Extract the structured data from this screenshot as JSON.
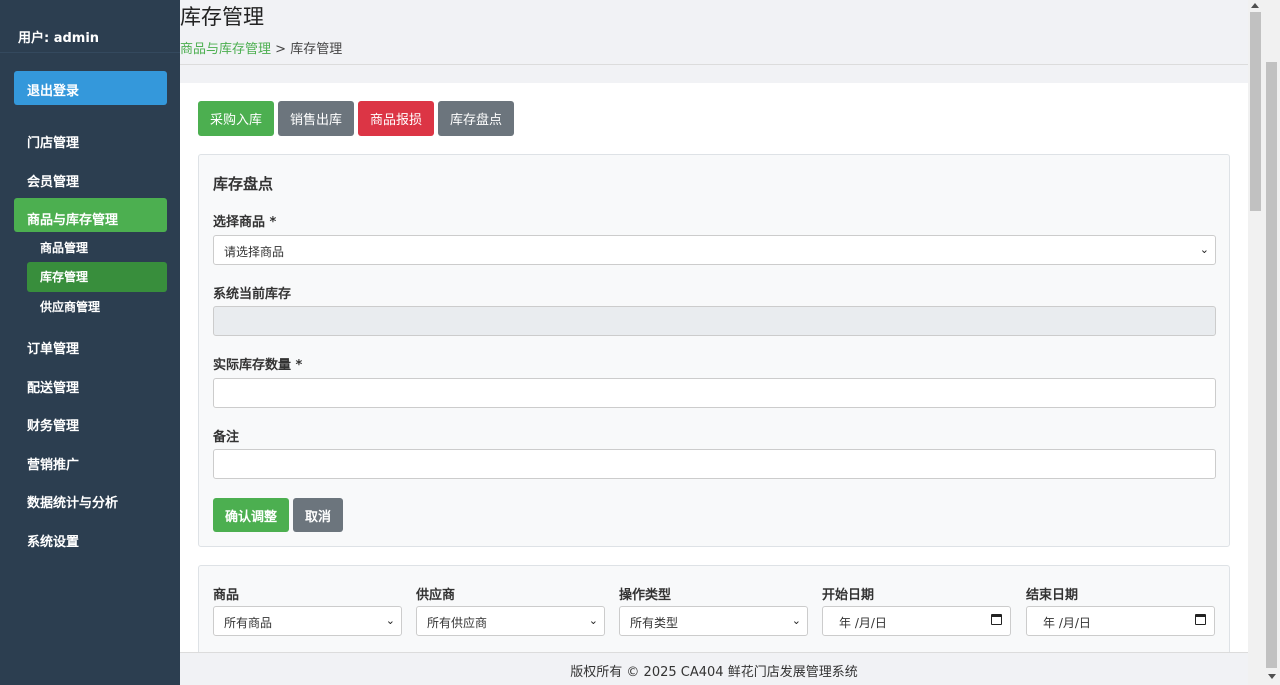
{
  "sidebar": {
    "user_label": "用户: admin",
    "logout_label": "退出登录",
    "items": [
      {
        "label": "门店管理"
      },
      {
        "label": "会员管理"
      },
      {
        "label": "商品与库存管理",
        "active": true
      },
      {
        "label": "订单管理"
      },
      {
        "label": "配送管理"
      },
      {
        "label": "财务管理"
      },
      {
        "label": "营销推广"
      },
      {
        "label": "数据统计与分析"
      },
      {
        "label": "系统设置"
      }
    ],
    "sub_items": [
      {
        "label": "商品管理"
      },
      {
        "label": "库存管理",
        "active": true
      },
      {
        "label": "供应商管理"
      }
    ]
  },
  "header": {
    "title": "库存管理",
    "breadcrumb_link": "商品与库存管理",
    "breadcrumb_sep": ">",
    "breadcrumb_current": "库存管理"
  },
  "actions": {
    "purchase_in": "采购入库",
    "sale_out": "销售出库",
    "damage": "商品报损",
    "stocktake": "库存盘点"
  },
  "form": {
    "title": "库存盘点",
    "product_label": "选择商品 *",
    "product_value": "请选择商品",
    "current_stock_label": "系统当前库存",
    "current_stock_value": "",
    "actual_qty_label": "实际库存数量 *",
    "actual_qty_value": "",
    "remark_label": "备注",
    "remark_value": "",
    "confirm_label": "确认调整",
    "cancel_label": "取消"
  },
  "filters": {
    "product_label": "商品",
    "product_value": "所有商品",
    "supplier_label": "供应商",
    "supplier_value": "所有供应商",
    "type_label": "操作类型",
    "type_value": "所有类型",
    "start_label": "开始日期",
    "start_value": "年 /月/日",
    "end_label": "结束日期",
    "end_value": "年 /月/日"
  },
  "footer": {
    "text": "版权所有 © 2025 CA404 鲜花门店发展管理系统"
  },
  "colors": {
    "sidebar_bg": "#2c3e50",
    "primary_blue": "#3498db",
    "accent_green": "#4caf50",
    "active_sub_green": "#388e3c",
    "danger_red": "#dc3545",
    "neutral_gray": "#6c757d"
  }
}
